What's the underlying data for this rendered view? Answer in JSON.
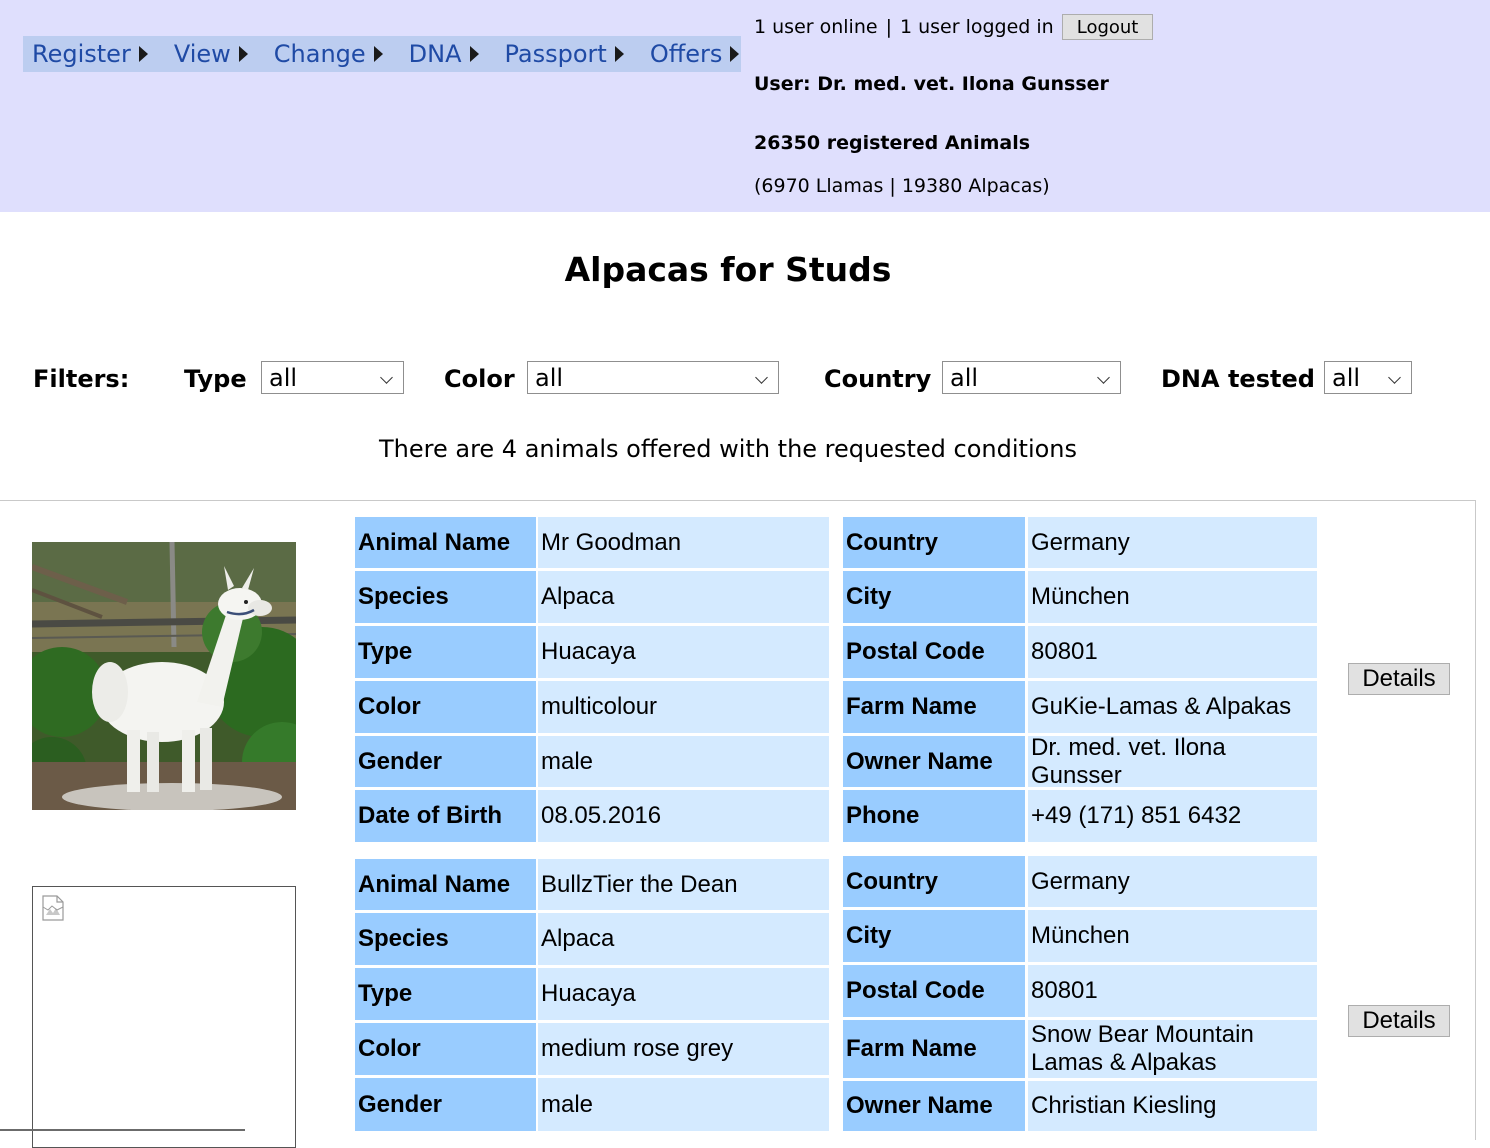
{
  "nav": {
    "items": [
      {
        "label": "Register"
      },
      {
        "label": "View"
      },
      {
        "label": "Change"
      },
      {
        "label": "DNA"
      },
      {
        "label": "Passport"
      },
      {
        "label": "Offers"
      }
    ]
  },
  "header": {
    "online_status": "1 user online",
    "separator": "|",
    "logged_status": "1 user logged in",
    "logout_label": "Logout",
    "user_line": "User: Dr. med. vet. Ilona Gunsser",
    "registered_count": "26350 registered Animals",
    "breakdown": "(6970 Llamas | 19380 Alpacas)"
  },
  "page_title": "Alpacas for Studs",
  "filters": {
    "heading": "Filters:",
    "type": {
      "label": "Type",
      "value": "all"
    },
    "color": {
      "label": "Color",
      "value": "all"
    },
    "country": {
      "label": "Country",
      "value": "all"
    },
    "dna": {
      "label": "DNA tested",
      "value": "all"
    }
  },
  "results_text": "There are 4 animals offered with the requested conditions",
  "details_label": "Details",
  "animals": [
    {
      "left": [
        {
          "label": "Animal Name",
          "value": "Mr Goodman"
        },
        {
          "label": "Species",
          "value": "Alpaca"
        },
        {
          "label": "Type",
          "value": "Huacaya"
        },
        {
          "label": "Color",
          "value": "multicolour"
        },
        {
          "label": "Gender",
          "value": "male"
        },
        {
          "label": "Date of Birth",
          "value": "08.05.2016"
        }
      ],
      "right": [
        {
          "label": "Country",
          "value": "Germany"
        },
        {
          "label": "City",
          "value": "München"
        },
        {
          "label": "Postal Code",
          "value": "80801"
        },
        {
          "label": "Farm Name",
          "value": "GuKie-Lamas & Alpakas"
        },
        {
          "label": "Owner Name",
          "value": "Dr. med. vet. Ilona Gunsser"
        },
        {
          "label": "Phone",
          "value": "+49 (171) 851 6432"
        }
      ]
    },
    {
      "left": [
        {
          "label": "Animal Name",
          "value": "BullzTier the Dean"
        },
        {
          "label": "Species",
          "value": "Alpaca"
        },
        {
          "label": "Type",
          "value": "Huacaya"
        },
        {
          "label": "Color",
          "value": "medium rose grey"
        },
        {
          "label": "Gender",
          "value": "male"
        }
      ],
      "right": [
        {
          "label": "Country",
          "value": "Germany"
        },
        {
          "label": "City",
          "value": "München"
        },
        {
          "label": "Postal Code",
          "value": "80801"
        },
        {
          "label": "Farm Name",
          "value": "Snow Bear Mountain Lamas & Alpakas"
        },
        {
          "label": "Owner Name",
          "value": "Christian Kiesling"
        }
      ]
    }
  ]
}
